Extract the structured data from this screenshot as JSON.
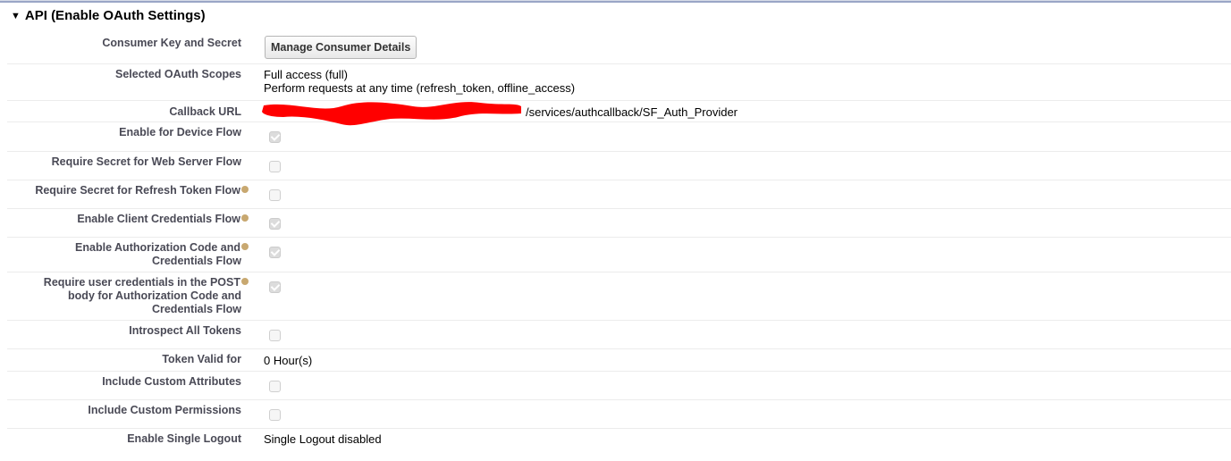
{
  "section": {
    "title": "API (Enable OAuth Settings)",
    "expanded": true
  },
  "rows": {
    "consumer_key": {
      "label": "Consumer Key and Secret",
      "button_label": "Manage Consumer Details"
    },
    "oauth_scopes": {
      "label": "Selected OAuth Scopes",
      "values": [
        "Full access (full)",
        "Perform requests at any time (refresh_token, offline_access)"
      ]
    },
    "callback_url": {
      "label": "Callback URL",
      "visible_value": "/services/authcallback/SF_Auth_Provider",
      "redacted_prefix": true
    },
    "device_flow": {
      "label": "Enable for Device Flow",
      "checked": true,
      "help": false
    },
    "secret_web_server": {
      "label": "Require Secret for Web Server Flow",
      "checked": false,
      "help": false
    },
    "secret_refresh_token": {
      "label": "Require Secret for Refresh Token Flow",
      "checked": false,
      "help": true
    },
    "client_credentials": {
      "label": "Enable Client Credentials Flow",
      "checked": true,
      "help": true
    },
    "auth_code_credentials": {
      "label_lines": [
        "Enable Authorization Code and",
        "Credentials Flow"
      ],
      "checked": true,
      "help": true
    },
    "user_credentials_post": {
      "label_lines": [
        "Require user credentials in the POST",
        "body for Authorization Code and",
        "Credentials Flow"
      ],
      "checked": true,
      "help": true
    },
    "introspect_tokens": {
      "label": "Introspect All Tokens",
      "checked": false,
      "help": false
    },
    "token_valid": {
      "label": "Token Valid for",
      "value": "0 Hour(s)"
    },
    "custom_attributes": {
      "label": "Include Custom Attributes",
      "checked": false,
      "help": false
    },
    "custom_permissions": {
      "label": "Include Custom Permissions",
      "checked": false,
      "help": false
    },
    "single_logout": {
      "label": "Enable Single Logout",
      "value": "Single Logout disabled"
    }
  },
  "colors": {
    "label_text": "#4a4a56",
    "help_icon": "#c8a870",
    "redaction": "#ff0000",
    "header_rule": "#9aa6c6"
  }
}
